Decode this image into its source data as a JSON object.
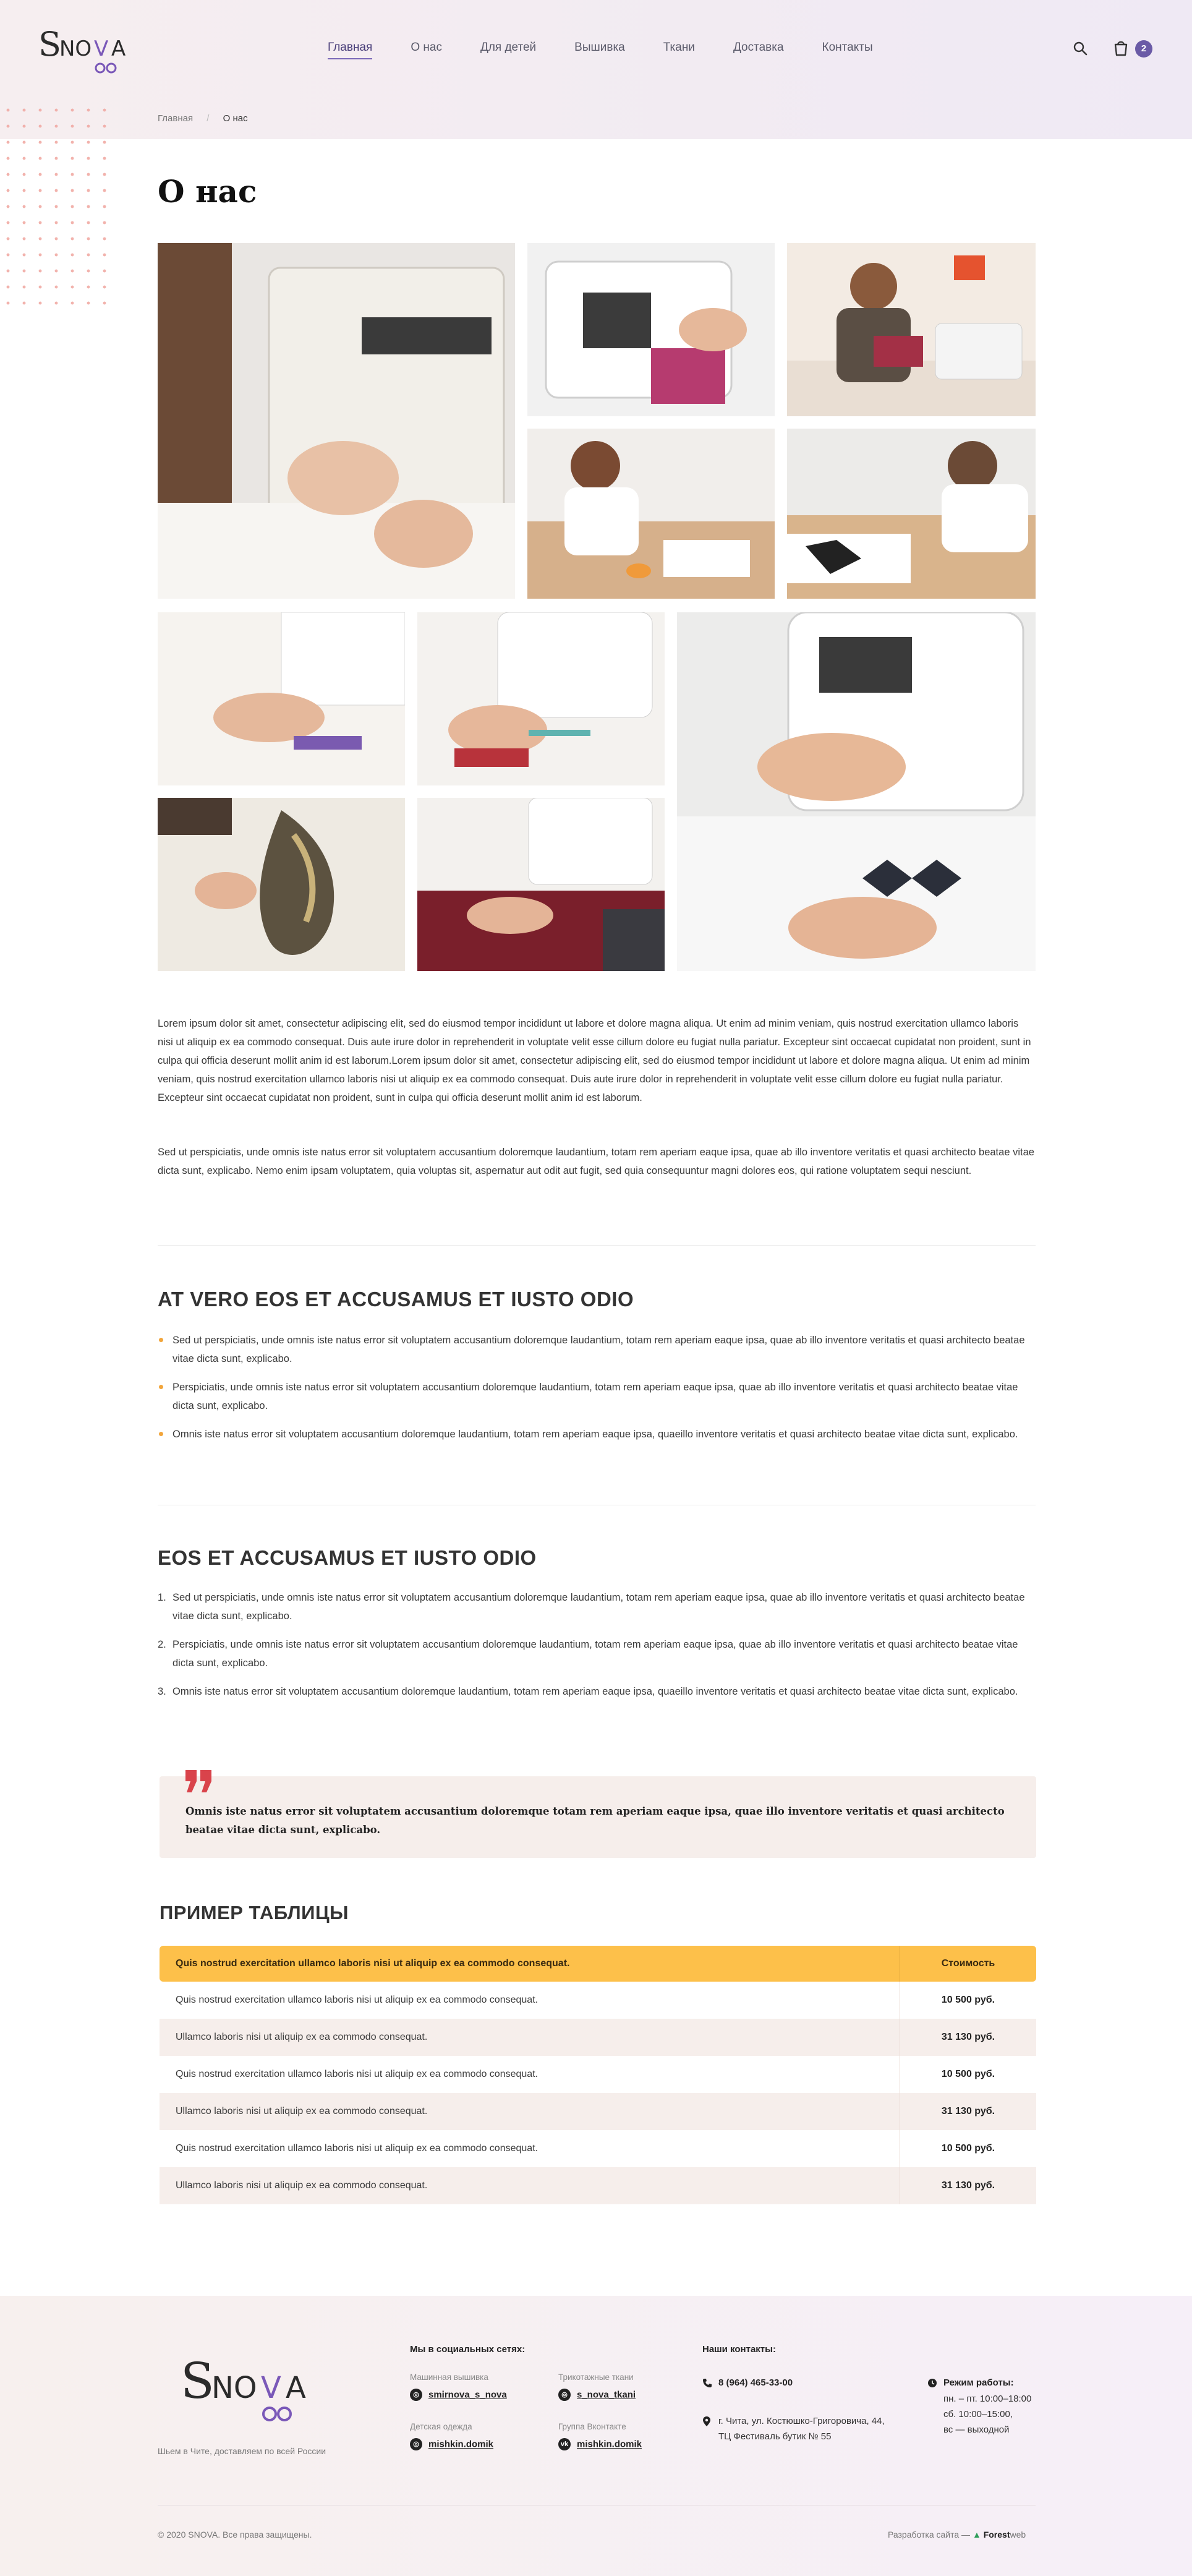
{
  "header": {
    "logo_text": "SNOVA",
    "nav": [
      "Главная",
      "О нас",
      "Для детей",
      "Вышивка",
      "Ткани",
      "Доставка",
      "Контакты"
    ],
    "cart_count": "2"
  },
  "breadcrumb": [
    "Главная",
    "О нас"
  ],
  "page_title": "О нас",
  "paragraphs": [
    "Lorem ipsum dolor sit amet, consectetur adipiscing elit, sed do eiusmod tempor incididunt ut labore et dolore magna aliqua. Ut enim ad minim veniam, quis nostrud exercitation ullamco laboris nisi ut aliquip ex ea commodo consequat. Duis aute irure dolor in reprehenderit in voluptate velit esse cillum dolore eu fugiat nulla pariatur. Excepteur sint occaecat cupidatat non proident, sunt in culpa qui officia deserunt mollit anim id est laborum.Lorem ipsum dolor sit amet, consectetur adipiscing elit, sed do eiusmod tempor incididunt ut labore et dolore magna aliqua. Ut enim ad minim veniam, quis nostrud exercitation ullamco laboris nisi ut aliquip ex ea commodo consequat. Duis aute irure dolor in reprehenderit in voluptate velit esse cillum dolore eu fugiat nulla pariatur. Excepteur sint occaecat cupidatat non proident, sunt in culpa qui officia deserunt mollit anim id est laborum.",
    "Sed ut perspiciatis, unde omnis iste natus error sit voluptatem accusantium doloremque laudantium, totam rem aperiam eaque ipsa, quae ab illo inventore veritatis et quasi architecto beatae vitae dicta sunt, explicabo. Nemo enim ipsam voluptatem, quia voluptas sit, aspernatur aut odit aut fugit, sed quia consequuntur magni dolores eos, qui ratione voluptatem sequi nesciunt."
  ],
  "section1": {
    "title": "AT VERO EOS ET ACCUSAMUS ET IUSTO ODIO",
    "items": [
      "Sed ut perspiciatis, unde omnis iste natus error sit voluptatem accusantium doloremque laudantium, totam rem aperiam eaque ipsa, quae ab illo inventore veritatis et quasi architecto beatae vitae dicta sunt, explicabo.",
      "Perspiciatis, unde omnis iste natus error sit voluptatem accusantium doloremque laudantium, totam rem aperiam eaque ipsa, quae ab illo inventore veritatis et quasi architecto beatae vitae dicta sunt, explicabo.",
      "Omnis iste natus error sit voluptatem accusantium doloremque laudantium, totam rem aperiam eaque ipsa, quaeillo inventore veritatis et quasi architecto beatae vitae dicta sunt, explicabo."
    ]
  },
  "section2": {
    "title": "EOS ET ACCUSAMUS ET IUSTO ODIO",
    "numbers": [
      "1.",
      "2.",
      "3."
    ],
    "items": [
      "Sed ut perspiciatis, unde omnis iste natus error sit voluptatem accusantium doloremque laudantium, totam rem aperiam eaque ipsa, quae ab illo inventore veritatis et quasi architecto beatae vitae dicta sunt, explicabo.",
      "Perspiciatis, unde omnis iste natus error sit voluptatem accusantium doloremque laudantium, totam rem aperiam eaque ipsa, quae ab illo inventore veritatis et quasi architecto beatae vitae dicta sunt, explicabo.",
      "Omnis iste natus error sit voluptatem accusantium doloremque laudantium, totam rem aperiam eaque ipsa, quaeillo inventore veritatis et quasi architecto beatae vitae dicta sunt, explicabo."
    ]
  },
  "quote": "Omnis iste natus error sit voluptatem accusantium doloremque totam rem aperiam eaque ipsa, quae illo inventore veritatis et quasi architecto beatae vitae dicta sunt, explicabo.",
  "table": {
    "title": "ПРИМЕР ТАБЛИЦЫ",
    "header": [
      "Quis nostrud exercitation ullamco laboris nisi ut aliquip ex ea commodo consequat.",
      "Стоимость"
    ],
    "rows": [
      [
        "Quis nostrud exercitation ullamco laboris nisi ut aliquip ex ea commodo consequat.",
        "10 500 руб."
      ],
      [
        "Ullamco laboris nisi ut aliquip ex ea commodo consequat.",
        "31 130 руб."
      ],
      [
        "Quis nostrud exercitation ullamco laboris nisi ut aliquip ex ea commodo consequat.",
        "10 500 руб."
      ],
      [
        "Ullamco laboris nisi ut aliquip ex ea commodo consequat.",
        "31 130 руб."
      ],
      [
        "Quis nostrud exercitation ullamco laboris nisi ut aliquip ex ea commodo consequat.",
        "10 500 руб."
      ],
      [
        "Ullamco laboris nisi ut aliquip ex ea commodo consequat.",
        "31 130 руб."
      ]
    ]
  },
  "footer": {
    "slogan": "Шьем в Чите, доставляем по всей России",
    "social_title": "Мы в социальных сетях:",
    "social": [
      {
        "caption": "Машинная вышивка",
        "handle": "smirnova_s_nova",
        "icon": "instagram-icon"
      },
      {
        "caption": "Трикотажные ткани",
        "handle": "s_nova_tkani",
        "icon": "instagram-icon"
      },
      {
        "caption": "Детская одежда",
        "handle": "mishkin.domik",
        "icon": "instagram-icon"
      },
      {
        "caption": "Группа Вконтакте",
        "handle": "mishkin.domik",
        "icon": "vk-icon"
      }
    ],
    "contacts_title": "Наши контакты:",
    "phone": "8 (964) 465-33-00",
    "address": "г. Чита, ул. Костюшко-Григоровича, 44, ТЦ Фестиваль бутик № 55",
    "hours_title": "Режим работы:",
    "hours": [
      "пн. – пт. 10:00–18:00",
      "сб. 10:00–15:00,",
      "вс — выходной"
    ],
    "copyright": "© 2020 SNOVA. Все права защищены.",
    "dev_label": "Разработка сайта —",
    "dev_name": "Forest",
    "dev_suffix": "web"
  },
  "colors": {
    "accent_purple": "#6a5aa6",
    "table_header": "#fdc04a",
    "bullet_orange": "#f2a53a",
    "quote_red": "#d9434b",
    "alt_row": "#f6eeeb"
  }
}
